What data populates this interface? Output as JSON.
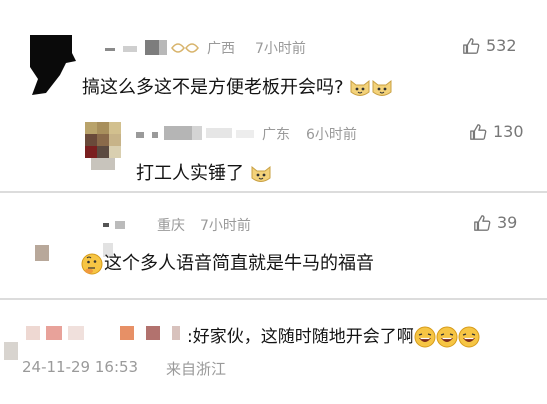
{
  "comments": [
    {
      "location": "广西",
      "time_ago": "7小时前",
      "likes": "532",
      "text": "搞这么多这不是方便老板开会吗?"
    },
    {
      "location": "广东",
      "time_ago": "6小时前",
      "likes": "130",
      "text": "打工人实锤了"
    },
    {
      "location": "重庆",
      "time_ago": "7小时前",
      "likes": "39",
      "text": "这个多人语音简直就是牛马的福音"
    },
    {
      "text": ":好家伙，这随时随地开会了啊",
      "datetime": "24-11-29 16:53",
      "source": "来自浙江"
    }
  ],
  "icons": {
    "like": "thumbs-up-icon",
    "cat_emoji": "cat-face-icon",
    "thinking_emoji": "thinking-face-icon",
    "laugh_emoji": "laughing-face-icon"
  },
  "colors": {
    "meta": "#9a9a9a",
    "divider": "#dcdcdc"
  }
}
